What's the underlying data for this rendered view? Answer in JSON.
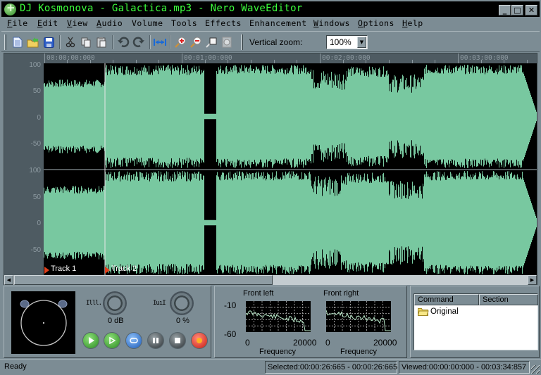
{
  "window": {
    "title": "DJ Kosmonova - Galactica.mp3 - Nero WaveEditor",
    "controls": {
      "minimize": "_",
      "maximize": "□",
      "close": "✕"
    }
  },
  "menu": [
    {
      "label": "File",
      "accel": "F"
    },
    {
      "label": "Edit",
      "accel": "E"
    },
    {
      "label": "View",
      "accel": "V"
    },
    {
      "label": "Audio",
      "accel": "A"
    },
    {
      "label": "Volume",
      "accel": ""
    },
    {
      "label": "Tools",
      "accel": ""
    },
    {
      "label": "Effects",
      "accel": ""
    },
    {
      "label": "Enhancement",
      "accel": ""
    },
    {
      "label": "Windows",
      "accel": "W"
    },
    {
      "label": "Options",
      "accel": "O"
    },
    {
      "label": "Help",
      "accel": "H"
    }
  ],
  "toolbar": {
    "buttons": [
      "new-file-icon",
      "open-file-icon",
      "save-icon",
      "cut-icon",
      "copy-icon",
      "paste-icon",
      "undo-icon",
      "redo-icon",
      "fit-to-window-icon",
      "zoom-in-icon",
      "zoom-out-icon",
      "zoom-selection-icon",
      "zoom-reset-icon"
    ],
    "vertical_zoom_label": "Vertical zoom:",
    "vertical_zoom_value": "100%"
  },
  "ruler": {
    "labels": [
      "00:00:00:000",
      "00:01:00:000",
      "00:02:00:000",
      "00:03:00:000"
    ]
  },
  "channels": {
    "y_labels": [
      "100",
      "50",
      "0",
      "-50"
    ]
  },
  "markers": [
    {
      "label": "Track 1"
    },
    {
      "label": "Track 2"
    }
  ],
  "transport": {
    "volume_label": "0 dB",
    "balance_label": "0 %",
    "buttons": [
      "play-icon",
      "play-selection-icon",
      "loop-icon",
      "pause-icon",
      "stop-icon",
      "record-icon"
    ]
  },
  "spectrum": {
    "left_title": "Front left",
    "right_title": "Front right",
    "y_max": "-10",
    "y_min": "-60",
    "x_min": "0",
    "x_max": "20000",
    "x_label": "Frequency"
  },
  "history": {
    "columns": [
      "Command",
      "Section"
    ],
    "rows": [
      {
        "command": "Original",
        "section": ""
      }
    ]
  },
  "status": {
    "ready": "Ready",
    "selected": "Selected:00:00:26:665 - 00:00:26:665",
    "viewed": "Viewed:00:00:00:000 - 00:03:34:857"
  },
  "colors": {
    "waveform": "#78c8a0",
    "title_text": "#3cff3c",
    "chrome": "#7c8c94"
  }
}
